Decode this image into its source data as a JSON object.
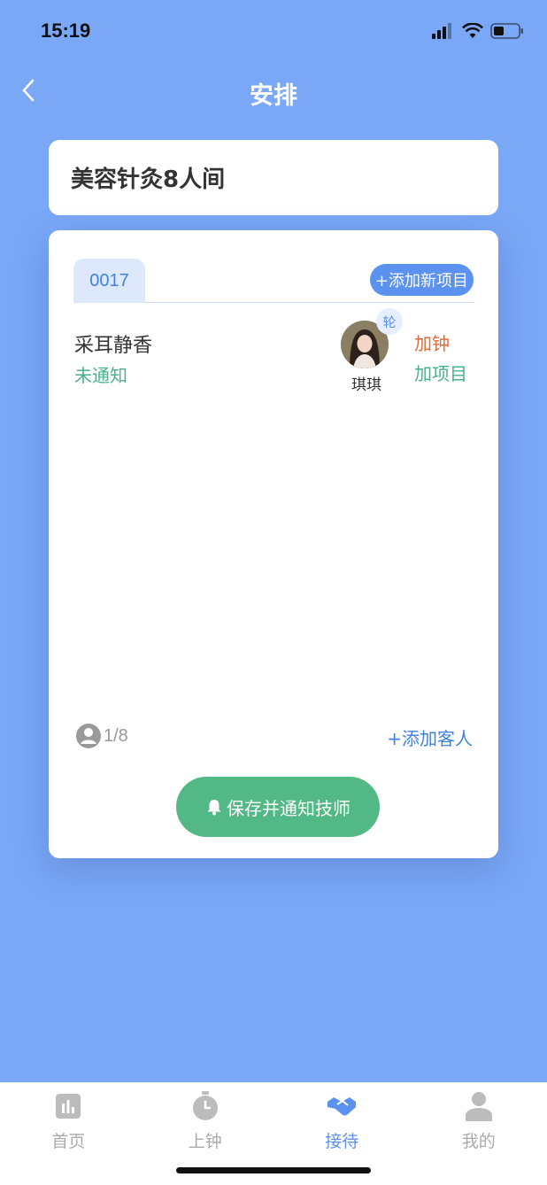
{
  "status": {
    "time": "15:19"
  },
  "header": {
    "title": "安排",
    "back_icon": "chevron-left-icon"
  },
  "room": {
    "name": "美容针灸8人间"
  },
  "card": {
    "tab_label": "0017",
    "add_project_label": "+添加新项目",
    "guest": {
      "name": "采耳静香",
      "status": "未通知",
      "technician": {
        "name": "琪琪",
        "badge": "轮"
      },
      "add_time_label": "加钟",
      "add_item_label": "加项目"
    },
    "count": "1/8",
    "add_guest_label": "+添加客人",
    "save_label": "保存并通知技师"
  },
  "tabbar": {
    "items": [
      {
        "label": "首页",
        "icon": "bar-chart-icon",
        "active": false
      },
      {
        "label": "上钟",
        "icon": "stopwatch-icon",
        "active": false
      },
      {
        "label": "接待",
        "icon": "handshake-icon",
        "active": true
      },
      {
        "label": "我的",
        "icon": "user-icon",
        "active": false
      }
    ]
  },
  "colors": {
    "background": "#7aa7f6",
    "accent": "#5b92f0",
    "green": "#52b885",
    "orange": "#e06a3c"
  }
}
